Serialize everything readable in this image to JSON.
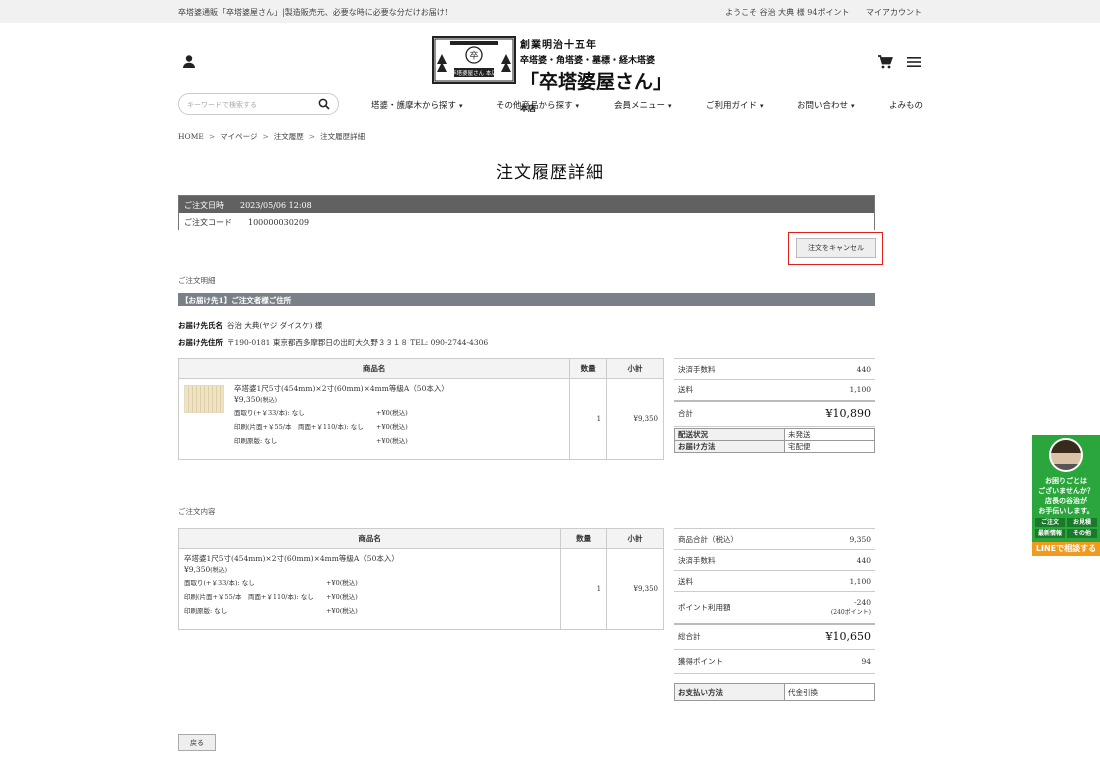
{
  "topbar": {
    "tagline": "卒塔婆通販「卒塔婆屋さん」|製造販売元、必要な時に必要な分だけお届け!",
    "welcome": "ようこそ 谷治 大典 様 94ポイント",
    "account": "マイアカウント"
  },
  "logo": {
    "line1": "創業明治十五年",
    "line2": "卒塔婆・角塔婆・墓標・経木塔婆",
    "main": "「卒塔婆屋さん」",
    "suffix": "本店",
    "box_char": "卒",
    "box_label": "卒塔婆屋さん 本店"
  },
  "search": {
    "placeholder": "キーワードで検索する"
  },
  "nav": [
    {
      "label": "塔婆・護摩木から探す",
      "caret": true
    },
    {
      "label": "その他商品から探す",
      "caret": true
    },
    {
      "label": "会員メニュー",
      "caret": true
    },
    {
      "label": "ご利用ガイド",
      "caret": true
    },
    {
      "label": "お問い合わせ",
      "caret": true
    },
    {
      "label": "よみもの",
      "caret": false
    }
  ],
  "breadcrumb": [
    "HOME",
    "マイページ",
    "注文履歴",
    "注文履歴詳細"
  ],
  "page_title": "注文履歴詳細",
  "order": {
    "date_label": "ご注文日時",
    "date_value": "2023/05/06 12:08",
    "code_label": "ご注文コード",
    "code_value": "100000030209"
  },
  "cancel_label": "注文をキャンセル",
  "section1_label": "ご注文明細",
  "destination": {
    "bar": "【お届け先1】ご注文者様ご住所",
    "name_label": "お届け先氏名",
    "name_value": "谷治 大典(ヤジ ダイスケ) 様",
    "addr_label": "お届け先住所",
    "addr_value": "〒190-0181 東京都西多摩郡日の出町大久野３３１８ TEL: 090-2744-4306"
  },
  "table_headers": {
    "product": "商品名",
    "qty": "数量",
    "subtotal": "小計"
  },
  "item": {
    "name": "卒塔婆1尺5寸(454mm)×2寸(60mm)×4mm等級A（50本入）",
    "price": "¥9,350",
    "price_tax": "(税込)",
    "options": [
      {
        "k": "面取り(+￥33/本): なし",
        "v": "+¥0(税込)"
      },
      {
        "k": "印刷(片面+￥55/本　両面+￥110/本): なし",
        "v": "+¥0(税込)"
      },
      {
        "k": "印刷原版: なし",
        "v": "+¥0(税込)"
      }
    ],
    "qty": "1",
    "subtotal": "¥9,350"
  },
  "summary1": {
    "fee_label": "決済手数料",
    "fee": "440",
    "ship_label": "送料",
    "ship": "1,100",
    "total_label": "合計",
    "total": "¥10,890"
  },
  "status1": {
    "delivery_label": "配送状況",
    "delivery": "未発送",
    "method_label": "お届け方法",
    "method": "宅配便"
  },
  "section2_label": "ご注文内容",
  "summary2": {
    "items_label": "商品合計（税込）",
    "items": "9,350",
    "fee_label": "決済手数料",
    "fee": "440",
    "ship_label": "送料",
    "ship": "1,100",
    "points_label": "ポイント利用額",
    "points": "-240",
    "points_note": "(240ポイント)",
    "total_label": "総合計",
    "total": "¥10,650",
    "earned_label": "獲得ポイント",
    "earned": "94"
  },
  "payment": {
    "label": "お支払い方法",
    "value": "代金引換"
  },
  "back_label": "戻る",
  "side_banner": {
    "text": [
      "お困りごとは",
      "ございませんか？",
      "店長の谷治が",
      "お手伝いします。"
    ],
    "buttons": [
      "ご注文",
      "お見積",
      "最新情報",
      "その他"
    ],
    "line": "LINEで相談する"
  }
}
